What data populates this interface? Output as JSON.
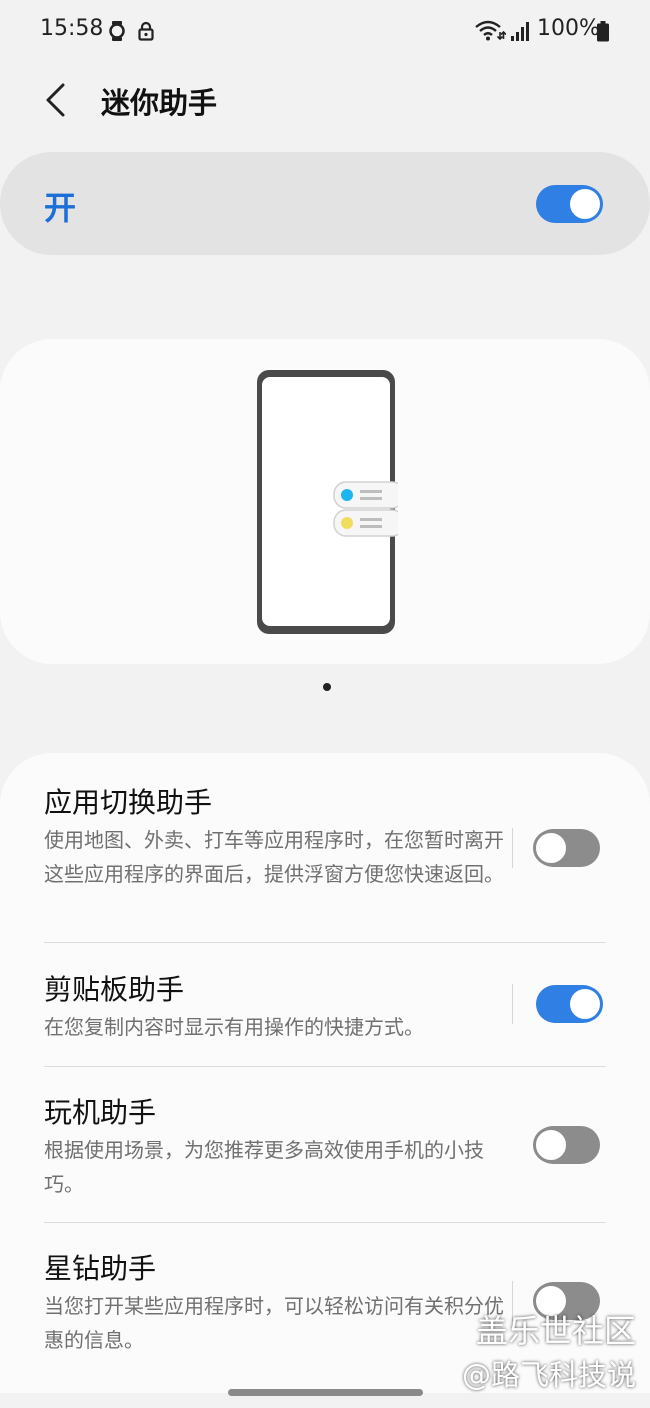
{
  "status_bar": {
    "time": "15:58",
    "battery_text": "100%",
    "icons": [
      "watch-icon",
      "lock-icon",
      "wifi-icon",
      "signal-icon",
      "battery-icon"
    ]
  },
  "header": {
    "back_icon": "chevron-left-icon",
    "title": "迷你助手"
  },
  "master_switch": {
    "label": "开",
    "enabled": true,
    "accent_color": "#1b6fd6"
  },
  "preview": {
    "pagination_dots": 1,
    "active_page": 1
  },
  "features": [
    {
      "title": "应用切换助手",
      "description": "使用地图、外卖、打车等应用程序时，在您暂时离开这些应用程序的界面后，提供浮窗方便您快速返回。",
      "enabled": false
    },
    {
      "title": "剪贴板助手",
      "description": "在您复制内容时显示有用操作的快捷方式。",
      "enabled": true
    },
    {
      "title": "玩机助手",
      "description": "根据使用场景，为您推荐更多高效使用手机的小技巧。",
      "enabled": false
    },
    {
      "title": "星钻助手",
      "description": "当您打开某些应用程序时，可以轻松访问有关积分优惠的信息。",
      "enabled": false
    }
  ],
  "watermark": {
    "line1": "盖乐世社区",
    "line2": "@路飞科技说"
  }
}
